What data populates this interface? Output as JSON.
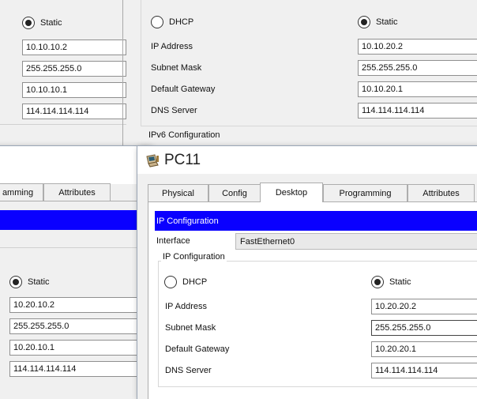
{
  "back_top": {
    "left_static_label": "Static",
    "left_fields": [
      "10.10.10.2",
      "255.255.255.0",
      "10.10.10.1",
      "114.114.114.114"
    ],
    "dhcp_label": "DHCP",
    "static_label": "Static",
    "labels": [
      "IP Address",
      "Subnet Mask",
      "Default Gateway",
      "DNS Server"
    ],
    "values": [
      "10.10.20.2",
      "255.255.255.0",
      "10.10.20.1",
      "114.114.114.114"
    ],
    "ipv6_label": "IPv6 Configuration"
  },
  "back_left": {
    "tabs": [
      "amming",
      "Attributes"
    ],
    "static_label": "Static",
    "fields": [
      "10.20.10.2",
      "255.255.255.0",
      "10.20.10.1",
      "114.114.114.114"
    ]
  },
  "pc11": {
    "title": "PC11",
    "tabs": [
      "Physical",
      "Config",
      "Desktop",
      "Programming",
      "Attributes"
    ],
    "header": "IP Configuration",
    "interface_label": "Interface",
    "interface_value": "FastEthernet0",
    "group_label": "IP Configuration",
    "dhcp_label": "DHCP",
    "static_label": "Static",
    "labels": [
      "IP Address",
      "Subnet Mask",
      "Default Gateway",
      "DNS Server"
    ],
    "values": [
      "10.20.20.2",
      "255.255.255.0",
      "10.20.20.1",
      "114.114.114.114"
    ]
  }
}
